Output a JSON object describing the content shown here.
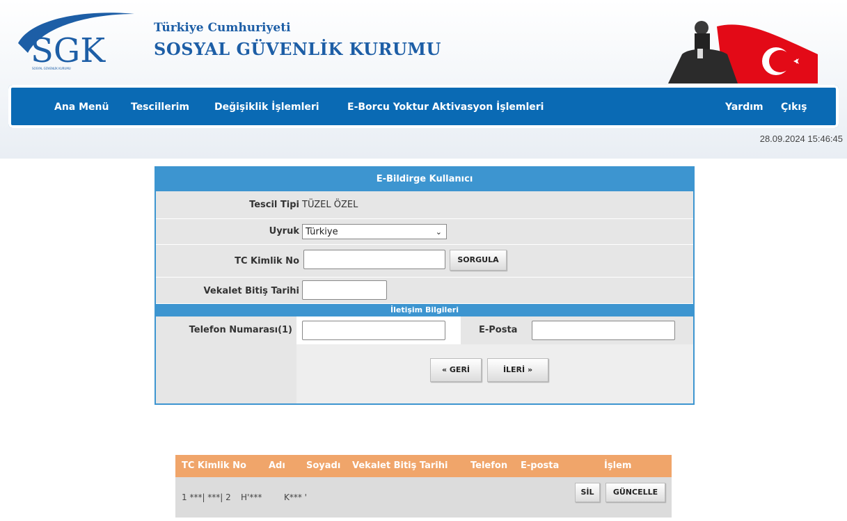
{
  "header": {
    "logo_text": "SGK",
    "logo_subtext": "SOSYAL GÜVENLİK KURUMU",
    "title_line1": "Türkiye Cumhuriyeti",
    "title_line2": "SOSYAL GÜVENLİK KURUMU"
  },
  "nav": {
    "left": [
      "Ana Menü",
      "Tescillerim",
      "Değişiklik İşlemleri",
      "E-Borcu Yoktur Aktivasyon İşlemleri"
    ],
    "right": [
      "Yardım",
      "Çıkış"
    ]
  },
  "datetime": "28.09.2024 15:46:45",
  "form": {
    "title": "E-Bildirge Kullanıcı",
    "tescil_tipi_label": "Tescil Tipi",
    "tescil_tipi_value": "TÜZEL ÖZEL",
    "uyruk_label": "Uyruk",
    "uyruk_value": "Türkiye",
    "tc_label": "TC Kimlik No",
    "tc_value": "",
    "sorgula_label": "SORGULA",
    "vekalet_label": "Vekalet Bitiş Tarihi",
    "vekalet_value": "",
    "contact_header": "İletişim Bilgileri",
    "telefon_label": "Telefon Numarası(1)",
    "telefon_value": "",
    "eposta_label": "E-Posta",
    "eposta_value": "",
    "geri_label": "« GERİ",
    "ileri_label": "İLERİ »"
  },
  "table": {
    "headers": [
      "TC Kimlik No",
      "Adı",
      "Soyadı",
      "Vekalet Bitiş Tarihi",
      "Telefon",
      "E-posta",
      "İşlem"
    ],
    "rows": [
      {
        "tc": "1 ***| ***| 2",
        "adi": "H'***",
        "soyadi": "K*** '",
        "sil": "SİL",
        "guncelle": "GÜNCELLE"
      }
    ]
  },
  "colors": {
    "nav_bg": "#0a6ab4",
    "panel_header": "#3d95d0",
    "table_header": "#f0a56a",
    "brand_blue": "#1d5ea6"
  }
}
